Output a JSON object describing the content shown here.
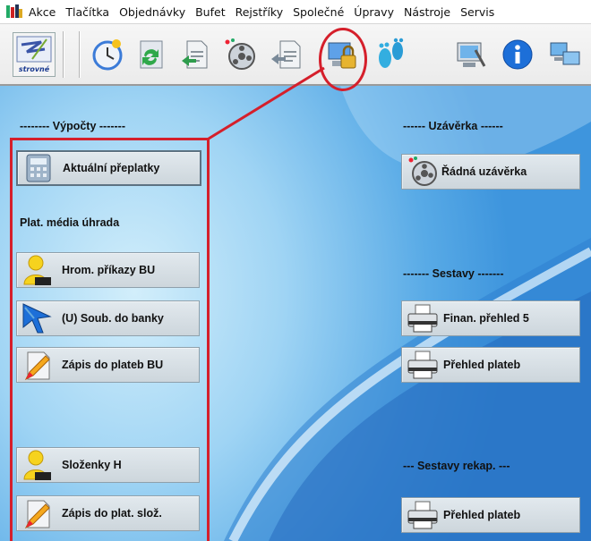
{
  "menubar": {
    "items": [
      "Akce",
      "Tlačítka",
      "Objednávky",
      "Bufet",
      "Rejstříky",
      "Společné",
      "Úpravy",
      "Nástroje",
      "Servis"
    ]
  },
  "toolbar": {
    "buttons": [
      {
        "name": "strovne-logo-icon"
      },
      {
        "name": "clock-refresh-icon"
      },
      {
        "name": "recycle-list-icon"
      },
      {
        "name": "document-import-icon"
      },
      {
        "name": "film-reel-icon"
      },
      {
        "name": "document-arrow-icon"
      },
      {
        "name": "lock-computer-icon"
      },
      {
        "name": "footprints-icon"
      },
      {
        "name": "computer-tools-icon"
      },
      {
        "name": "info-icon"
      },
      {
        "name": "computers-network-icon"
      }
    ],
    "logo_text": "strovné"
  },
  "sections": {
    "vypocty": "-------- Výpočty -------",
    "plat_media": "Plat. média úhrada",
    "uzaverka": "------ Uzávěrka ------",
    "sestavy": "------- Sestavy -------",
    "sestavy_rekap": "--- Sestavy rekap. ---"
  },
  "buttons": {
    "aktualni_preplatky": "Aktuální přeplatky",
    "hrom_prikazy": "Hrom. příkazy BU",
    "soub_do_banky": "(U) Soub. do banky",
    "zapis_plateb_bu": "Zápis do plateb BU",
    "slozenky_h": "Složenky H",
    "zapis_plat_sloz": "Zápis do plat. slož.",
    "radna_uzaverka": "Řádná uzávěrka",
    "finan_prehled": "Finan. přehled 5",
    "prehled_plateb": "Přehled plateb",
    "prehled_plateb_rekap": "Přehled plateb"
  },
  "colors": {
    "annotation_red": "#d51f2b",
    "background_blue": "#4a9de0",
    "button_gray": "#d3dbe0"
  }
}
